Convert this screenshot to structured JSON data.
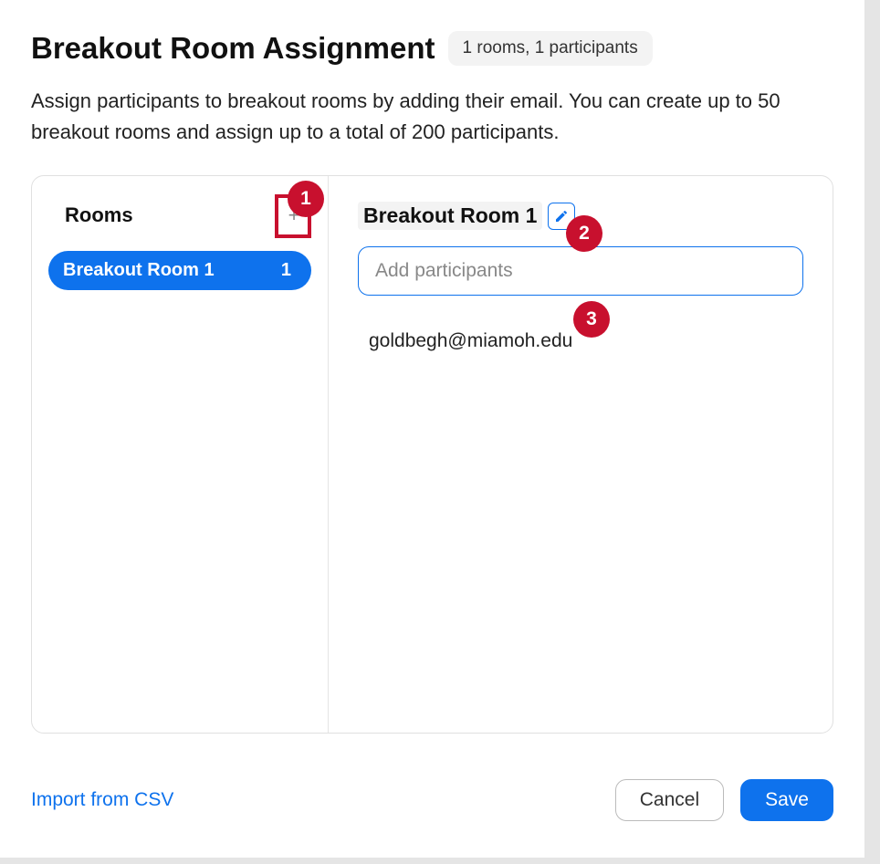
{
  "header": {
    "title": "Breakout Room Assignment",
    "summary": "1 rooms, 1 participants"
  },
  "description": "Assign participants to breakout rooms by adding their email. You can create up to 50 breakout rooms and assign up to a total of 200 participants.",
  "sidebar": {
    "title": "Rooms",
    "add_icon": "+",
    "items": [
      {
        "label": "Breakout Room 1",
        "count": "1"
      }
    ]
  },
  "content": {
    "room_name": "Breakout Room 1",
    "input_placeholder": "Add participants",
    "participants": [
      "goldbegh@miamoh.edu"
    ]
  },
  "callouts": {
    "c1": "1",
    "c2": "2",
    "c3": "3"
  },
  "footer": {
    "import_link": "Import from CSV",
    "cancel": "Cancel",
    "save": "Save"
  }
}
